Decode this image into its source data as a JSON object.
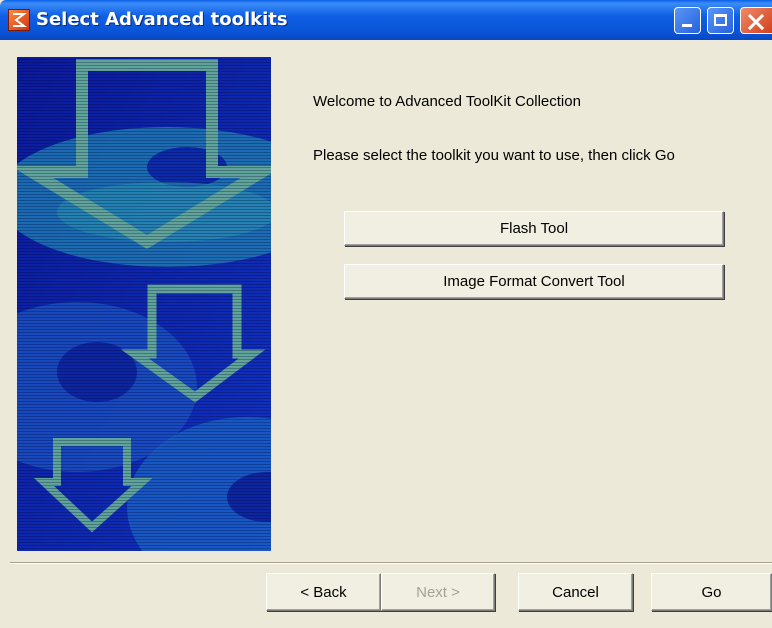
{
  "window": {
    "title": "Select Advanced toolkits"
  },
  "content": {
    "welcome_text": "Welcome to Advanced ToolKit Collection",
    "instruction_text": "Please select the toolkit you want to use, then click Go"
  },
  "toolkits": [
    {
      "label": "Flash Tool"
    },
    {
      "label": "Image Format Convert Tool"
    }
  ],
  "footer": {
    "back_label": "< Back",
    "next_label": "Next >",
    "next_enabled": false,
    "cancel_label": "Cancel",
    "go_label": "Go"
  },
  "colors": {
    "titlebar": "#0a54d6",
    "dialog_bg": "#ece9d8",
    "banner_blue": "#0a1fa8",
    "arrow_green": "#5fa39a"
  },
  "icons": {
    "app": "app-icon",
    "minimize": "minimize-icon",
    "maximize": "maximize-icon",
    "close": "close-icon"
  }
}
